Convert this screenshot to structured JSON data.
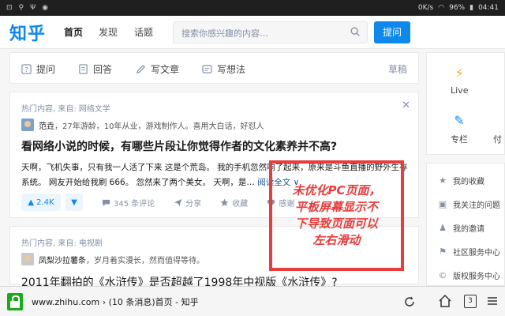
{
  "statusbar": {
    "net_speed": "0K/s",
    "battery": "96%",
    "time": "04:41"
  },
  "header": {
    "logo": "知乎",
    "nav": [
      {
        "label": "首页"
      },
      {
        "label": "发现"
      },
      {
        "label": "话题"
      }
    ],
    "search_placeholder": "搜索你感兴趣的内容…",
    "ask_button": "提问"
  },
  "composer": {
    "items": [
      {
        "label": "提问",
        "icon": "question-icon"
      },
      {
        "label": "回答",
        "icon": "answer-icon"
      },
      {
        "label": "写文章",
        "icon": "pen-icon"
      },
      {
        "label": "写想法",
        "icon": "idea-icon"
      }
    ],
    "draft": "草稿"
  },
  "feed": [
    {
      "source": "热门内容, 来自: 网络文学",
      "author_name": "范垚",
      "author_bio": "，27年游龄，10年从业，游戏制作人。喜用大白话，好怼人",
      "title": "看网络小说的时候，有哪些片段让你觉得作者的文化素养并不高?",
      "excerpt": "天啊，飞机失事，只有我一人活了下来 这是个荒岛。 我的手机忽然响了起来，原来是斗鱼直播的野外生存系统。 网友开始给我刷 666。 忽然来了两个美女。 天啊，是…",
      "read_more": "阅读全文 ∨",
      "votes": "2.4K",
      "comments": "345 条评论",
      "share": "分享",
      "collect": "收藏",
      "thanks": "感谢"
    },
    {
      "source": "热门内容, 来自: 电视剧",
      "author_name": "凤梨沙拉薯条",
      "author_bio": "，岁月着实漫长，然而值得等待。",
      "title": "2011年翻拍的《水浒传》是否超越了1998年中视版《水浒传》?"
    }
  ],
  "sidebar_top": [
    {
      "label": "Live",
      "icon": "lightning-icon"
    },
    {
      "label": "专栏",
      "icon": "pen-icon"
    },
    {
      "label": "付",
      "icon": "pay-icon"
    }
  ],
  "sidebar_links": [
    {
      "label": "我的收藏"
    },
    {
      "label": "我关注的问题"
    },
    {
      "label": "我的邀请"
    },
    {
      "label": "社区服务中心"
    },
    {
      "label": "版权服务中心"
    }
  ],
  "annotation": {
    "text": "未优化PC页面，\n平板屏幕显示不\n下导致页面可以\n左右滑动"
  },
  "browser": {
    "url_domain": "www.zhihu.com",
    "url_rest": " › (10 条消息)首页 - 知乎",
    "tab_count": "3"
  },
  "colors": {
    "brand": "#0f88eb",
    "annotation": "#e63d3d",
    "secure": "#1aad19"
  }
}
